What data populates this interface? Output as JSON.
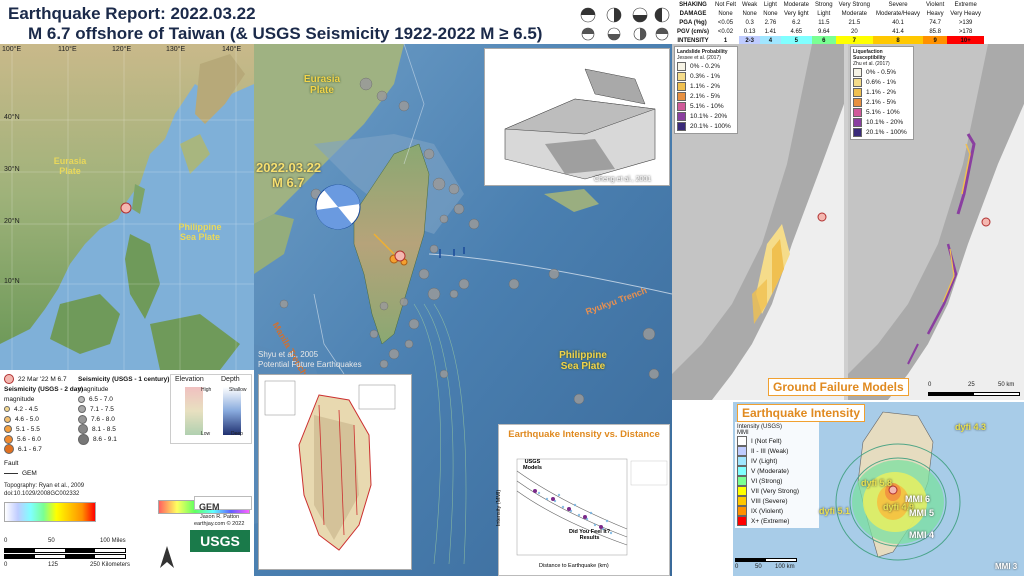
{
  "header": {
    "title": "Earthquake Report: 2022.03.22",
    "subtitle": "M 6.7 offshore of Taiwan (& USGS Seismicity 1922-2022 M ≥ 6.5)"
  },
  "overview_map": {
    "lon_labels": [
      "100°E",
      "110°E",
      "120°E",
      "130°E",
      "140°E"
    ],
    "lat_labels": [
      "40°N",
      "30°N",
      "20°N",
      "10°N"
    ],
    "plate_eurasia": "Eurasia\nPlate",
    "plate_philippine": "Philippine\nSea Plate"
  },
  "main_map": {
    "plate_eurasia": "Eurasia\nPlate",
    "plate_philippine": "Philippine\nSea Plate",
    "event_date": "2022.03.22",
    "event_mag": "M 6.7",
    "ryukyu": "Ryukyu Trench",
    "manila": "Manila Trench",
    "shyu_line1": "Shyu et al., 2005",
    "shyu_line2": "Potential Future Earthquakes",
    "cheng": "Cheng et al., 2001"
  },
  "shaking_table": {
    "rows": [
      {
        "label": "SHAKING",
        "cells": [
          "Not Felt",
          "Weak",
          "Light",
          "Moderate",
          "Strong",
          "Very Strong",
          "Severe",
          "Violent",
          "Extreme"
        ]
      },
      {
        "label": "DAMAGE",
        "cells": [
          "None",
          "None",
          "None",
          "Very light",
          "Light",
          "Moderate",
          "Moderate/Heavy",
          "Heavy",
          "Very Heavy"
        ]
      },
      {
        "label": "PGA (%g)",
        "cells": [
          "<0.05",
          "0.3",
          "2.76",
          "6.2",
          "11.5",
          "21.5",
          "40.1",
          "74.7",
          ">139"
        ]
      },
      {
        "label": "PGV (cm/s)",
        "cells": [
          "<0.02",
          "0.13",
          "1.41",
          "4.65",
          "9.64",
          "20",
          "41.4",
          "85.8",
          ">178"
        ]
      }
    ],
    "intensity_label": "INTENSITY",
    "intensity_values": [
      "1",
      "2-3",
      "4",
      "5",
      "6",
      "7",
      "8",
      "9",
      "10+"
    ],
    "intensity_colors": [
      "#ffffff",
      "#bfccff",
      "#a0e6ff",
      "#80ffff",
      "#7aff93",
      "#ffff00",
      "#ffc800",
      "#ff9100",
      "#ff0000"
    ]
  },
  "legend": {
    "epicenter": "22 Mar '22 M 6.7",
    "usgs2day_title": "Seismicity (USGS - 2 day)",
    "usgs2day_sub": "magnitude",
    "usgs2day": [
      "4.2 - 4.5",
      "4.6 - 5.0",
      "5.1 - 5.5",
      "5.6 - 6.0",
      "6.1 - 6.7"
    ],
    "century_title": "Seismicity (USGS - 1 century)",
    "century_sub": "magnitude",
    "century": [
      "6.5 - 7.0",
      "7.1 - 7.5",
      "7.6 - 8.0",
      "8.1 - 8.5",
      "8.6 - 9.1"
    ],
    "elevation": "Elevation",
    "depth": "Depth",
    "high": "High",
    "low": "Low",
    "shallow": "Shallow",
    "deep": "Deep",
    "fault": "Fault",
    "gem": "GEM",
    "topo1": "Topography: Ryan et al., 2009",
    "topo2": "doi:10.1029/2008GC002332",
    "credit1": "Jason R. Patton",
    "credit2": "earthjay.com © 2022",
    "scale_miles": [
      "0",
      "50",
      "100 Miles"
    ],
    "scale_km": [
      "0",
      "125",
      "250 Kilometers"
    ]
  },
  "ground_failure": {
    "title": "Ground Failure Models",
    "landslide_title": "Landslide Probability",
    "landslide_src": "Jessee et al. (2017)",
    "landslide_bins": [
      "0% - 0.2%",
      "0.3% - 1%",
      "1.1% - 2%",
      "2.1% - 5%",
      "5.1% - 10%",
      "10.1% - 20%",
      "20.1% - 100%"
    ],
    "liq_title": "Liquefaction Susceptibility",
    "liq_src": "Zhu et al. (2017)",
    "liq_bins": [
      "0% - 0.5%",
      "0.6% - 1%",
      "1.1% - 2%",
      "2.1% - 5%",
      "5.1% - 10%",
      "10.1% - 20%",
      "20.1% - 100%"
    ],
    "bin_colors": [
      "#f7f4e6",
      "#f5dc8a",
      "#f0c050",
      "#e89040",
      "#d05a9a",
      "#8a3fa0",
      "#3a2a7a"
    ],
    "scale": [
      "0",
      "25",
      "50 km"
    ]
  },
  "intensity_vs_distance": {
    "title": "Earthquake Intensity vs. Distance",
    "usgs_models": "USGS\nModels",
    "dyfi": "Did You Feel It?\nResults",
    "xlabel": "Distance to Earthquake (km)",
    "ylabel": "Intensity (MMI)"
  },
  "intensity_map": {
    "title": "Earthquake Intensity",
    "mmi": "MMI",
    "usgs": "Intensity (USGS)",
    "classes": [
      "I (Not Felt)",
      "II - III (Weak)",
      "IV (Light)",
      "V (Moderate)",
      "VI (Strong)",
      "VII (Very Strong)",
      "VIII (Severe)",
      "IX (Violent)",
      "X+ (Extreme)"
    ],
    "class_colors": [
      "#ffffff",
      "#bfccff",
      "#a0e6ff",
      "#80ffff",
      "#7aff93",
      "#ffff00",
      "#ffc800",
      "#ff9100",
      "#ff0000"
    ],
    "dyfi_labels": [
      "dyfi 4.3",
      "dyfi 4.9",
      "dyfi 5.1",
      "dyfi 5.8"
    ],
    "mmi_labels": [
      "MMI 6",
      "MMI 5",
      "MMI 4",
      "MMI 3"
    ],
    "scale": [
      "0",
      "50",
      "100 km"
    ]
  }
}
